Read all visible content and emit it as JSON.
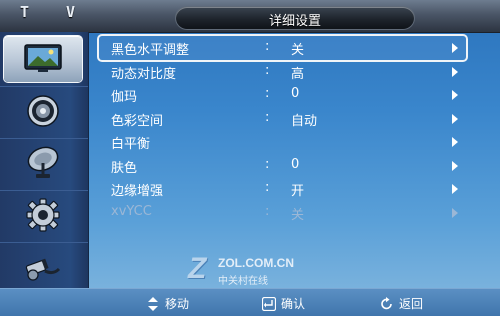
{
  "header": {
    "source_label": "T V",
    "title": "详细设置"
  },
  "sidebar": {
    "items": [
      {
        "icon": "picture-icon",
        "active": true
      },
      {
        "icon": "sound-icon",
        "active": false
      },
      {
        "icon": "channel-icon",
        "active": false
      },
      {
        "icon": "setup-icon",
        "active": false
      },
      {
        "icon": "input-icon",
        "active": false
      }
    ]
  },
  "menu": {
    "items": [
      {
        "label": "黑色水平调整",
        "colon": ":",
        "value": "关",
        "selected": true,
        "enabled": true
      },
      {
        "label": "动态对比度",
        "colon": ":",
        "value": "高",
        "selected": false,
        "enabled": true
      },
      {
        "label": "伽玛",
        "colon": ":",
        "value": "0",
        "selected": false,
        "enabled": true
      },
      {
        "label": "色彩空间",
        "colon": ":",
        "value": "自动",
        "selected": false,
        "enabled": true
      },
      {
        "label": "白平衡",
        "colon": "",
        "value": "",
        "selected": false,
        "enabled": true
      },
      {
        "label": "肤色",
        "colon": ":",
        "value": "0",
        "selected": false,
        "enabled": true
      },
      {
        "label": "边缘增强",
        "colon": ":",
        "value": "开",
        "selected": false,
        "enabled": true
      },
      {
        "label": "xvYCC",
        "colon": ":",
        "value": "关",
        "selected": false,
        "enabled": false
      }
    ]
  },
  "watermark": {
    "letter": "Z",
    "site": "ZOL.COM.CN",
    "chinese": "中关村在线"
  },
  "footer": {
    "move_label": "移动",
    "enter_label": "确认",
    "return_label": "返回"
  },
  "colors": {
    "background_top": "#2a72bb",
    "background_bottom": "#86b9df",
    "sidebar": "#274a7e",
    "selection_border": "#f0f4f8",
    "disabled_text": "#9bb7d6"
  }
}
